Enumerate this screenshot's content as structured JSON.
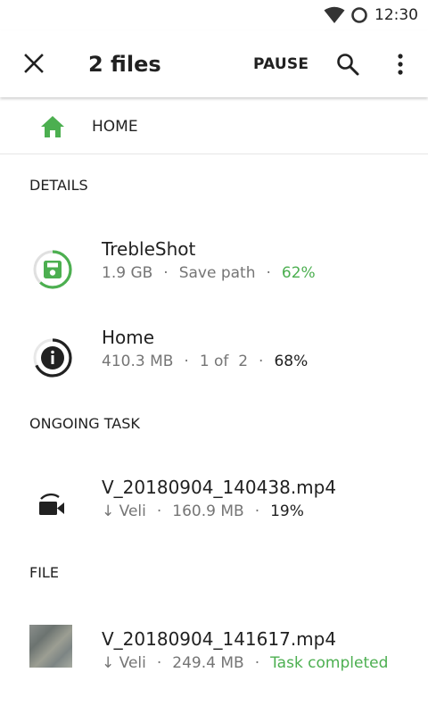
{
  "status_bar": {
    "time": "12:30"
  },
  "toolbar": {
    "title": "2 files",
    "pause_label": "PAUSE"
  },
  "breadcrumb": {
    "home_label": "HOME"
  },
  "sections": {
    "details": "DETAILS",
    "ongoing": "ONGOING TASK",
    "file": "FILE"
  },
  "details": [
    {
      "name": "TrebleShot",
      "size": "1.9 GB",
      "sub": "Save path",
      "percent": "62%",
      "progress": 0.62
    },
    {
      "name": "Home",
      "size": "410.3 MB",
      "sub": "1 of  2",
      "percent": "68%",
      "progress": 0.68
    }
  ],
  "ongoing": {
    "name": "V_20180904_140438.mp4",
    "sender": "↓ Veli",
    "size": "160.9 MB",
    "percent": "19%"
  },
  "file": {
    "name": "V_20180904_141617.mp4",
    "sender": "↓ Veli",
    "size": "249.4 MB",
    "status": "Task completed"
  },
  "separator": "·",
  "colors": {
    "accent": "#4CAF50",
    "text": "#212121",
    "secondary": "#757575"
  }
}
